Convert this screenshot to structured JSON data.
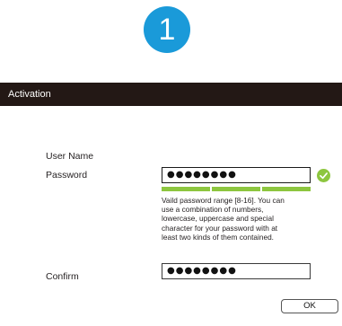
{
  "step": {
    "number": "1",
    "color": "#1a9ad9"
  },
  "window": {
    "title": "Activation",
    "titlebar_color": "#231815"
  },
  "form": {
    "username_label": "User Name",
    "password_label": "Password",
    "password_value": "●●●●●●●●",
    "password_valid_icon": "check-circle-icon",
    "strength": {
      "segments": 3,
      "filled": 3,
      "color": "#8dc63f"
    },
    "hint": "Vaild password  range [8-16]. You can\nuse a combination of numbers,\nlowercase, uppercase and special\ncharacter for your password with at\nleast two kinds of them contained.",
    "confirm_label": "Confirm",
    "confirm_value": "●●●●●●●●"
  },
  "buttons": {
    "ok_label": "OK"
  }
}
